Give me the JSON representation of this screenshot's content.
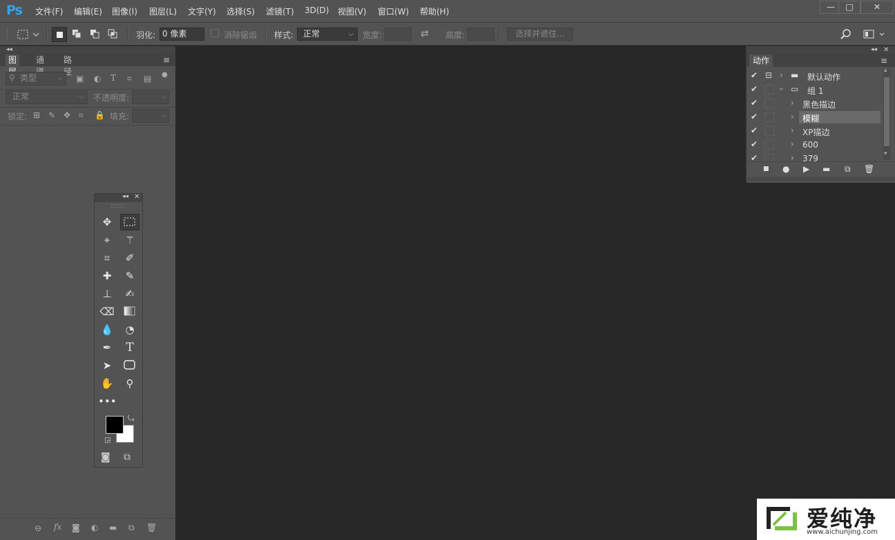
{
  "app": {
    "logo": "Ps"
  },
  "menu": [
    "文件(F)",
    "编辑(E)",
    "图像(I)",
    "图层(L)",
    "文字(Y)",
    "选择(S)",
    "滤镜(T)",
    "3D(D)",
    "视图(V)",
    "窗口(W)",
    "帮助(H)"
  ],
  "window_controls": {
    "minimize": "—",
    "maximize": "□",
    "close": "✕"
  },
  "options": {
    "feather_label": "羽化:",
    "feather_value": "0 像素",
    "antialias_label": "消除锯齿",
    "style_label": "样式:",
    "style_value": "正常",
    "width_label": "宽度:",
    "height_label": "高度:",
    "select_mask_button": "选择并遮住..."
  },
  "layers_panel": {
    "tabs": [
      "图层",
      "通道",
      "路径"
    ],
    "filter_placeholder": "类型",
    "blend_mode": "正常",
    "opacity_label": "不透明度:",
    "lock_label": "锁定:",
    "fill_label": "填充:",
    "footer_fx": "fx"
  },
  "actions_panel": {
    "tab": "动作",
    "rows": [
      {
        "label": "默认动作",
        "level": 0,
        "checked": true
      },
      {
        "label": "组 1",
        "level": 0,
        "checked": true
      },
      {
        "label": "黑色描边",
        "level": 1,
        "checked": true
      },
      {
        "label": "模糊",
        "level": 1,
        "checked": true,
        "selected": true
      },
      {
        "label": "XP描边",
        "level": 1,
        "checked": true
      },
      {
        "label": "600",
        "level": 1,
        "checked": true
      },
      {
        "label": "379",
        "level": 1,
        "checked": true
      }
    ]
  },
  "watermark": {
    "brand": "爱纯净",
    "url": "www.aichunjing.com"
  },
  "colors": {
    "foreground": "#000000",
    "background": "#ffffff",
    "accent": "#3aa0e8"
  }
}
